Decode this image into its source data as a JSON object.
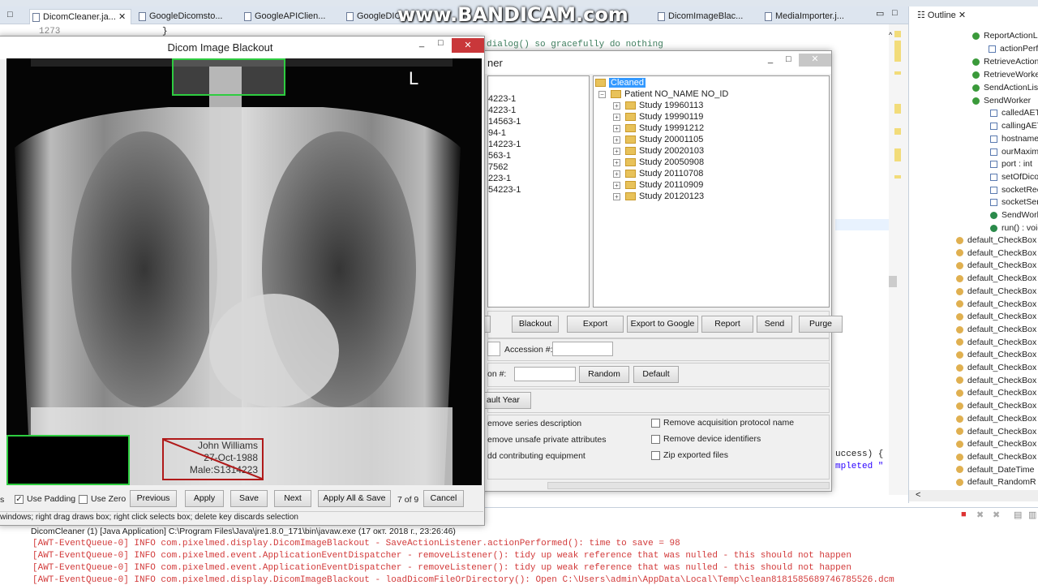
{
  "eclipse": {
    "tabs": [
      "DicomCleaner.ja...",
      "GoogleDicomsto...",
      "GoogleAPIClien...",
      "GoogleDIC...",
      "DicomImageBlac...",
      "MediaImporter.j..."
    ],
    "line_number": "1273",
    "code_lines": [
      "}",
      "dialog() so gracefully do nothing",
      "uccess) {",
      "mpleted \""
    ],
    "outline": {
      "title": "Outline",
      "items": [
        "ReportActionListe",
        "actionPerfor",
        "RetrieveActionList",
        "RetrieveWorker",
        "SendActionListen",
        "SendWorker",
        "calledAETitle",
        "callingAETitle",
        "hostname : S",
        "ourMaximum",
        "port : int",
        "setOfDicomF",
        "socketReceiv",
        "socketSendB",
        "SendWorker(",
        "run() : void",
        "default_CheckBox",
        "default_CheckBox",
        "default_CheckBox",
        "default_CheckBox",
        "default_CheckBox",
        "default_CheckBox",
        "default_CheckBox",
        "default_CheckBox",
        "default_CheckBox",
        "default_CheckBox",
        "default_CheckBox",
        "default_CheckBox",
        "default_CheckBox",
        "default_CheckBox",
        "default_CheckBox",
        "default_CheckBox",
        "default_CheckBox",
        "default_CheckBox",
        "default_DateTime",
        "default_RandomR"
      ]
    },
    "console": {
      "header": "DicomCleaner (1) [Java Application] C:\\Program Files\\Java\\jre1.8.0_171\\bin\\javaw.exe (17 окт. 2018 г., 23:26:46)",
      "lines": [
        "[AWT-EventQueue-0] INFO com.pixelmed.display.DicomImageBlackout - SaveActionListener.actionPerformed(): time to save = 98",
        "[AWT-EventQueue-0] INFO com.pixelmed.event.ApplicationEventDispatcher - removeListener(): tidy up weak reference that was nulled - this should not happen",
        "[AWT-EventQueue-0] INFO com.pixelmed.event.ApplicationEventDispatcher - removeListener(): tidy up weak reference that was nulled - this should not happen",
        "[AWT-EventQueue-0] INFO com.pixelmed.display.DicomImageBlackout - loadDicomFileOrDirectory(): Open C:\\Users\\admin\\AppData\\Local\\Temp\\clean8181585689746785526.dcm"
      ]
    }
  },
  "watermark": "www.BANDICAM.com",
  "cleaner": {
    "title_partial": "ner",
    "left_list": [
      "4223-1",
      "4223-1",
      "14563-1",
      "94-1",
      "14223-1",
      "563-1",
      "7562",
      "223-1",
      "54223-1"
    ],
    "tree": {
      "root": "Cleaned",
      "patient": "Patient NO_NAME NO_ID",
      "studies": [
        "Study 19960113",
        "Study 19990119",
        "Study 19991212",
        "Study 20001105",
        "Study 20020103",
        "Study 20050908",
        "Study 20110708",
        "Study 20110909",
        "Study 20120123"
      ]
    },
    "buttons": [
      "Blackout",
      "Export",
      "Export to Google",
      "Report",
      "Send",
      "Purge"
    ],
    "accession_label": "Accession #:",
    "accession_value": "",
    "row2_label": "on #:",
    "row2_value": "",
    "random": "Random",
    "default": "Default",
    "default_year": "ault Year",
    "options_left": [
      "emove series description",
      "emove unsafe private attributes",
      "dd contributing equipment"
    ],
    "options_right": [
      {
        "label": "Remove acquisition protocol name",
        "checked": false
      },
      {
        "label": "Remove device identifiers",
        "checked": false
      },
      {
        "label": "Zip exported files",
        "checked": false
      }
    ]
  },
  "blackout": {
    "title": "Dicom Image Blackout",
    "orientation_marker": "L",
    "burned_text": [
      "John Williams",
      "27-Oct-1988",
      "Male:S1314223"
    ],
    "toolbar": {
      "cut_label": "s",
      "use_padding": "Use Padding",
      "use_padding_checked": true,
      "use_zero": "Use Zero",
      "use_zero_checked": false,
      "previous": "Previous",
      "apply": "Apply",
      "save": "Save",
      "next": "Next",
      "apply_all": "Apply All & Save",
      "counter": "7 of 9",
      "cancel": "Cancel"
    },
    "status": "windows; right drag draws box; right click selects box; delete key discards selection"
  }
}
